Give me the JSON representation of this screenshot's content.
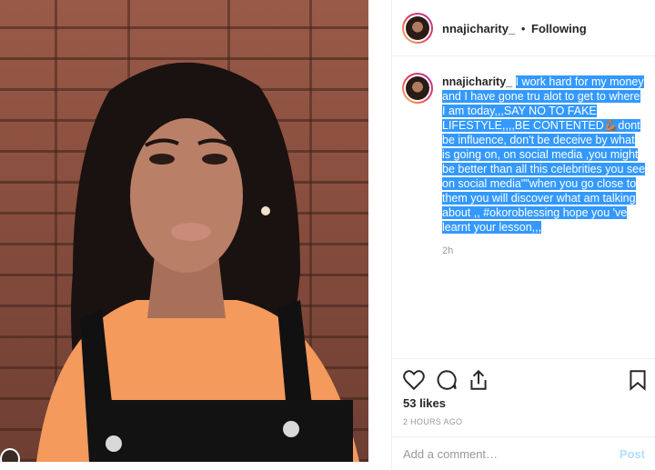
{
  "post": {
    "username": "nnajicharity_",
    "separator": "•",
    "follow_label": "Following",
    "caption_text": "I work hard for my money and I have gone tru alot to get to where I am today,,,SAY NO TO FAKE LIFESTYLE,,,,BE CONTENTED💪🏽dont be influence, don't be deceive by what is going on, on social media ,you might be better than all this celebrities you see on social media\"\"when you go close to them you will discover what am talking about ,, #okoroblessing hope you 've learnt your lesson,,,",
    "caption_time": "2h",
    "likes": "53 likes",
    "posted": "2 HOURS AGO"
  },
  "comment": {
    "placeholder": "Add a comment…",
    "post_label": "Post"
  },
  "colors": {
    "selection": "#3399ff",
    "post_button": "#b2dffc",
    "avatar_ring": "#e8375a"
  },
  "icons": [
    "heart-icon",
    "comment-icon",
    "share-icon",
    "bookmark-icon"
  ]
}
